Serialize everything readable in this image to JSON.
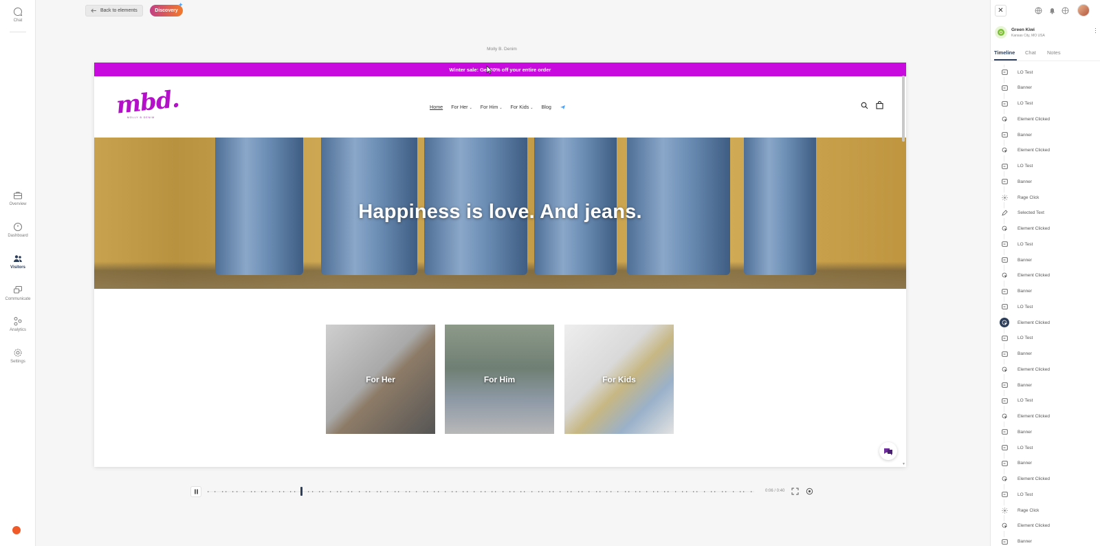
{
  "left_nav": {
    "items": [
      {
        "label": "Chat",
        "icon": "chat-icon"
      },
      {
        "label": "Overview",
        "icon": "briefcase-icon"
      },
      {
        "label": "Dashboard",
        "icon": "gauge-icon"
      },
      {
        "label": "Visitors",
        "icon": "users-icon",
        "active": true
      },
      {
        "label": "Communicate",
        "icon": "messages-icon"
      },
      {
        "label": "Analytics",
        "icon": "analytics-icon"
      },
      {
        "label": "Settings",
        "icon": "gear-icon"
      }
    ]
  },
  "toolbar": {
    "back_label": "Back to elements",
    "discovery_label": "Discovery"
  },
  "site": {
    "title": "Molly B. Denim",
    "announcement": "Winter sale: Get 30% off your entire order",
    "logo": "mbd.",
    "logo_sub": "MOLLY B DENIM",
    "nav": [
      "Home",
      "For Her",
      "For Him",
      "For Kids",
      "Blog"
    ],
    "hero_headline": "Happiness is love. And jeans.",
    "categories": [
      "For Her",
      "For Him",
      "For Kids"
    ]
  },
  "playback": {
    "time": "0:06 / 0:40",
    "progress": 0.17
  },
  "visitor": {
    "name": "Green Kiwi",
    "location": "Kansas City, MO USA"
  },
  "tabs": [
    "Timeline",
    "Chat",
    "Notes"
  ],
  "timeline": [
    {
      "label": "LO Test",
      "icon": "tag-icon"
    },
    {
      "label": "Banner",
      "icon": "tag-icon"
    },
    {
      "label": "LO Test",
      "icon": "tag-icon"
    },
    {
      "label": "Element Clicked",
      "icon": "click-icon"
    },
    {
      "label": "Banner",
      "icon": "tag-icon"
    },
    {
      "label": "Element Clicked",
      "icon": "click-icon"
    },
    {
      "label": "LO Test",
      "icon": "tag-icon"
    },
    {
      "label": "Banner",
      "icon": "tag-icon"
    },
    {
      "label": "Rage Click",
      "icon": "rage-click-icon"
    },
    {
      "label": "Selected Text",
      "icon": "pen-icon"
    },
    {
      "label": "Element Clicked",
      "icon": "click-icon"
    },
    {
      "label": "LO Test",
      "icon": "tag-icon"
    },
    {
      "label": "Banner",
      "icon": "tag-icon"
    },
    {
      "label": "Element Clicked",
      "icon": "click-icon"
    },
    {
      "label": "Banner",
      "icon": "tag-icon"
    },
    {
      "label": "LO Test",
      "icon": "tag-icon"
    },
    {
      "label": "Element Clicked",
      "icon": "click-icon",
      "selected": true
    },
    {
      "label": "LO Test",
      "icon": "tag-icon"
    },
    {
      "label": "Banner",
      "icon": "tag-icon"
    },
    {
      "label": "Element Clicked",
      "icon": "click-icon"
    },
    {
      "label": "Banner",
      "icon": "tag-icon"
    },
    {
      "label": "LO Test",
      "icon": "tag-icon"
    },
    {
      "label": "Element Clicked",
      "icon": "click-icon"
    },
    {
      "label": "Banner",
      "icon": "tag-icon"
    },
    {
      "label": "LO Test",
      "icon": "tag-icon"
    },
    {
      "label": "Banner",
      "icon": "tag-icon"
    },
    {
      "label": "Element Clicked",
      "icon": "click-icon"
    },
    {
      "label": "LO Test",
      "icon": "tag-icon"
    },
    {
      "label": "Rage Click",
      "icon": "rage-click-icon"
    },
    {
      "label": "Element Clicked",
      "icon": "click-icon"
    },
    {
      "label": "Banner",
      "icon": "tag-icon"
    }
  ],
  "colors": {
    "accent": "#2c3e5a",
    "brand_magenta": "#c80adf",
    "discovery_gradient_start": "#c23f85",
    "discovery_gradient_end": "#f27a2a"
  }
}
